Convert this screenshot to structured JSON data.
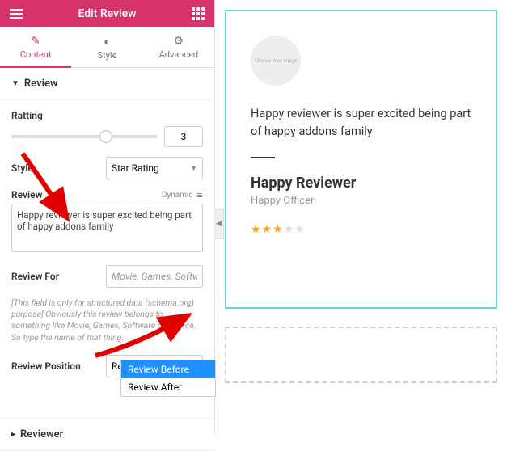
{
  "header": {
    "title": "Edit Review"
  },
  "tabs": [
    {
      "label": "Content"
    },
    {
      "label": "Style"
    },
    {
      "label": "Advanced"
    }
  ],
  "section_review": {
    "title": "Review",
    "rating_label": "Ratting",
    "rating_value": "3",
    "style_label": "Style",
    "style_value": "Star Rating",
    "review_label": "Review",
    "dynamic_label": "Dynamic",
    "review_text": "Happy reviewer is super excited being part of happy addons family",
    "review_for_label": "Review For",
    "review_for_placeholder": "Movie, Games, Software",
    "help_text": "[This field is only for structured data (schema.org) purpose] Obviously this review belongs to something like Movie, Games, Software or Service. So type the name of that thing.",
    "review_position_label": "Review Position",
    "review_position_value": "Review Before",
    "review_position_options": [
      "Review Before",
      "Review After"
    ]
  },
  "section_reviewer": {
    "title": "Reviewer"
  },
  "preview": {
    "avatar_placeholder": "Choose Your Image",
    "text": "Happy reviewer is super excited being part of happy addons family",
    "name": "Happy Reviewer",
    "role": "Happy Officer",
    "rating": 3,
    "max_rating": 5
  }
}
